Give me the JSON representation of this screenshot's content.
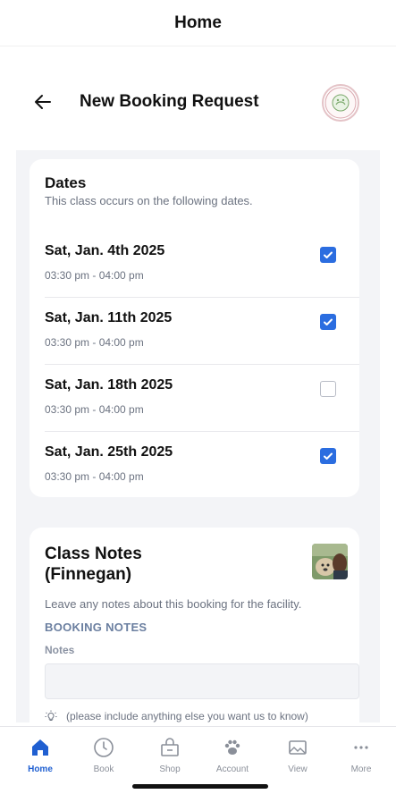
{
  "app": {
    "title": "Home"
  },
  "header": {
    "title": "New Booking Request"
  },
  "dates_section": {
    "title": "Dates",
    "subtitle": "This class occurs on the following dates.",
    "dates": [
      {
        "date": "Sat, Jan. 4th 2025",
        "time": "03:30 pm - 04:00 pm",
        "checked": true
      },
      {
        "date": "Sat, Jan. 11th 2025",
        "time": "03:30 pm - 04:00 pm",
        "checked": true
      },
      {
        "date": "Sat, Jan. 18th 2025",
        "time": "03:30 pm - 04:00 pm",
        "checked": false
      },
      {
        "date": "Sat, Jan. 25th 2025",
        "time": "03:30 pm - 04:00 pm",
        "checked": true
      }
    ]
  },
  "class_notes": {
    "title_line1": "Class Notes",
    "title_line2": "(Finnegan)",
    "subtitle": "Leave any notes about this booking for the facility.",
    "section_header": "BOOKING NOTES",
    "notes_label": "Notes",
    "notes_value": "",
    "hint": "(please include anything else you want us to know)"
  },
  "tabbar": {
    "tabs": [
      {
        "label": "Home",
        "icon": "home-icon",
        "active": true
      },
      {
        "label": "Book",
        "icon": "clock-icon",
        "active": false
      },
      {
        "label": "Shop",
        "icon": "shop-icon",
        "active": false
      },
      {
        "label": "Account",
        "icon": "paw-icon",
        "active": false
      },
      {
        "label": "View",
        "icon": "gallery-icon",
        "active": false
      },
      {
        "label": "More",
        "icon": "more-icon",
        "active": false
      }
    ]
  },
  "colors": {
    "accent": "#2b6de0",
    "active_tab": "#1f5fd1",
    "background": "#f3f4f7"
  }
}
